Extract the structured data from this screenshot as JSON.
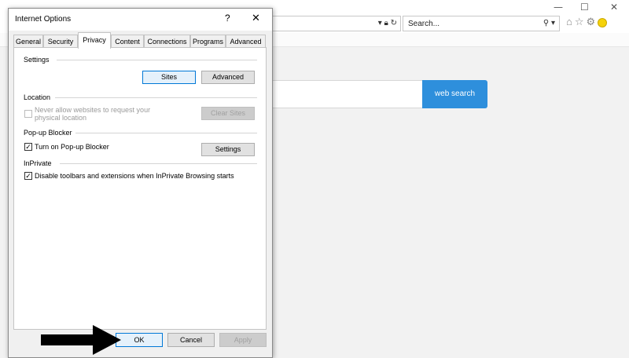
{
  "dialog": {
    "title": "Internet Options",
    "help_glyph": "?",
    "close_glyph": "✕",
    "tabs": [
      {
        "label": "General"
      },
      {
        "label": "Security"
      },
      {
        "label": "Privacy"
      },
      {
        "label": "Content"
      },
      {
        "label": "Connections"
      },
      {
        "label": "Programs"
      },
      {
        "label": "Advanced"
      }
    ],
    "active_tab": "Privacy",
    "settings": {
      "group_label": "Settings",
      "sites_button": "Sites",
      "advanced_button": "Advanced"
    },
    "location": {
      "group_label": "Location",
      "checkbox_label_line1": "Never allow websites to request your",
      "checkbox_label_line2": "physical location",
      "checked": false,
      "clear_sites_button": "Clear Sites"
    },
    "popup_blocker": {
      "group_label": "Pop-up Blocker",
      "checkbox_label": "Turn on Pop-up Blocker",
      "checked": true,
      "settings_button": "Settings"
    },
    "inprivate": {
      "group_label": "InPrivate",
      "checkbox_label": "Disable toolbars and extensions when InPrivate Browsing starts",
      "checked": true
    },
    "footer": {
      "ok": "OK",
      "cancel": "Cancel",
      "apply": "Apply"
    }
  },
  "browser": {
    "search_placeholder": "Search...",
    "web_search_button": "web search",
    "window_controls": {
      "minimize": "—",
      "maximize": "☐",
      "close": "✕"
    },
    "toolbar_icons": [
      "home-icon",
      "favorites-star-icon",
      "settings-gear-icon",
      "feedback-smiley-icon"
    ]
  },
  "colors": {
    "accent_blue": "#2e8fdc",
    "focus_border": "#0078d7"
  }
}
